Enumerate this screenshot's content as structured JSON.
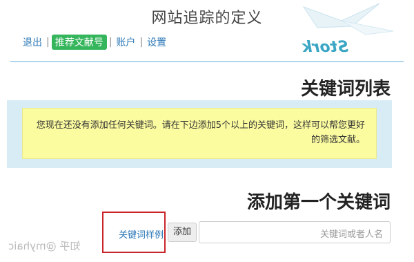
{
  "page_title": "网站追踪的定义",
  "brand": {
    "name": "Stork",
    "accent_color": "#3aa6c4"
  },
  "topnav": {
    "settings": "设置",
    "account": "账户",
    "recommend": "推荐文献号",
    "logout": "退出",
    "separator": "|",
    "active_color": "#35b55c"
  },
  "keywords_section": {
    "heading": "关键词列表",
    "notice": "您现在还没有添加任何关键词。请在下边添加5个以上的关键词，这样可以帮您更好的筛选文献。"
  },
  "add_section": {
    "heading": "添加第一个关键词",
    "input_placeholder": "关键词或者人名",
    "add_button": "添加",
    "example_link": "关键词样例"
  },
  "watermark": "知乎 @myhaic"
}
